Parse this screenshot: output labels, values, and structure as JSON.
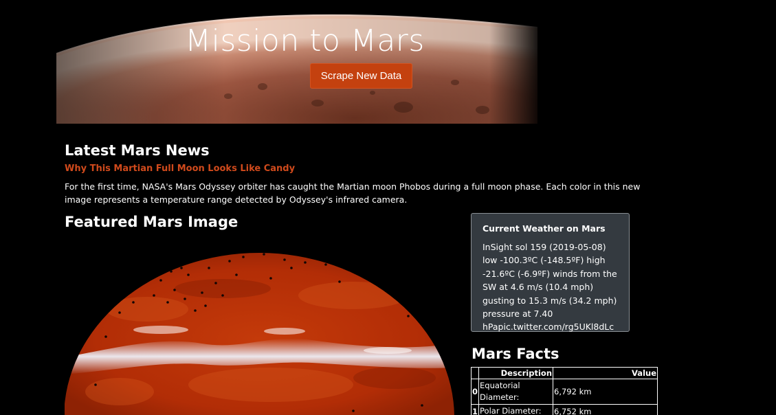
{
  "hero": {
    "title": "Mission to Mars",
    "button_label": "Scrape New Data",
    "accent_color": "#c4410f"
  },
  "news": {
    "heading": "Latest Mars News",
    "title": "Why This Martian Full Moon Looks Like Candy",
    "body": "For the first time, NASA's Mars Odyssey orbiter has caught the Martian moon Phobos during a full moon phase. Each color in this new image represents a temperature range detected by Odyssey's infrared camera."
  },
  "featured": {
    "heading": "Featured Mars Image"
  },
  "weather": {
    "title": "Current Weather on Mars",
    "body": "InSight sol 159 (2019-05-08) low -100.3ºC (-148.5ºF) high -21.6ºC (-6.9ºF) winds from the SW at 4.6 m/s (10.4 mph) gusting to 15.3 m/s (34.2 mph) pressure at 7.40 hPapic.twitter.com/rg5UKl8dLc"
  },
  "facts": {
    "heading": "Mars Facts",
    "columns": [
      "",
      "Description",
      "Value"
    ],
    "rows": [
      {
        "index": "0",
        "description": "Equatorial Diameter:",
        "value": "6,792 km"
      },
      {
        "index": "1",
        "description": "Polar Diameter:",
        "value": "6,752 km"
      }
    ]
  }
}
